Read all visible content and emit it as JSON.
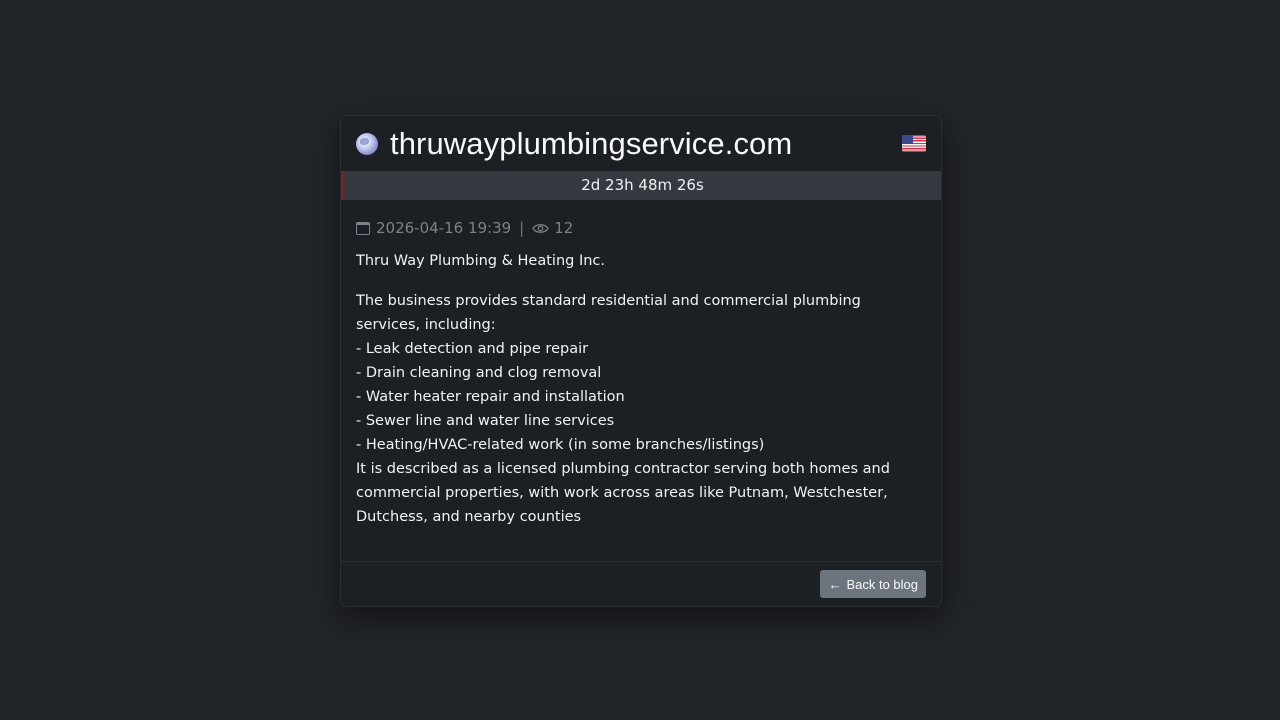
{
  "header": {
    "domain": "thruwayplumbingservice.com",
    "globe_icon": "globe-icon",
    "flag_icon": "us-flag-icon"
  },
  "timer": "2d 23h 48m 26s",
  "meta": {
    "date": "2026-04-16 19:39",
    "separator": "|",
    "views": "12"
  },
  "company": "Thru Way Plumbing & Heating Inc.",
  "description": "The business provides standard residential and commercial plumbing services, including:\n- Leak detection and pipe repair\n- Drain cleaning and clog removal\n- Water heater repair and installation\n- Sewer line and water line services\n- Heating/HVAC-related work (in some branches/listings)\nIt is described as a licensed plumbing contractor serving both homes and commercial properties, with work across areas like Putnam, Westchester, Dutchess, and nearby counties",
  "footer": {
    "back_label": "Back to blog",
    "back_icon": "arrow-left-icon"
  },
  "colors": {
    "background": "#212428",
    "card": "#1c1f23",
    "timer_bar": "#343a40",
    "timer_accent": "#8b1a1a",
    "button": "#6c757d"
  }
}
